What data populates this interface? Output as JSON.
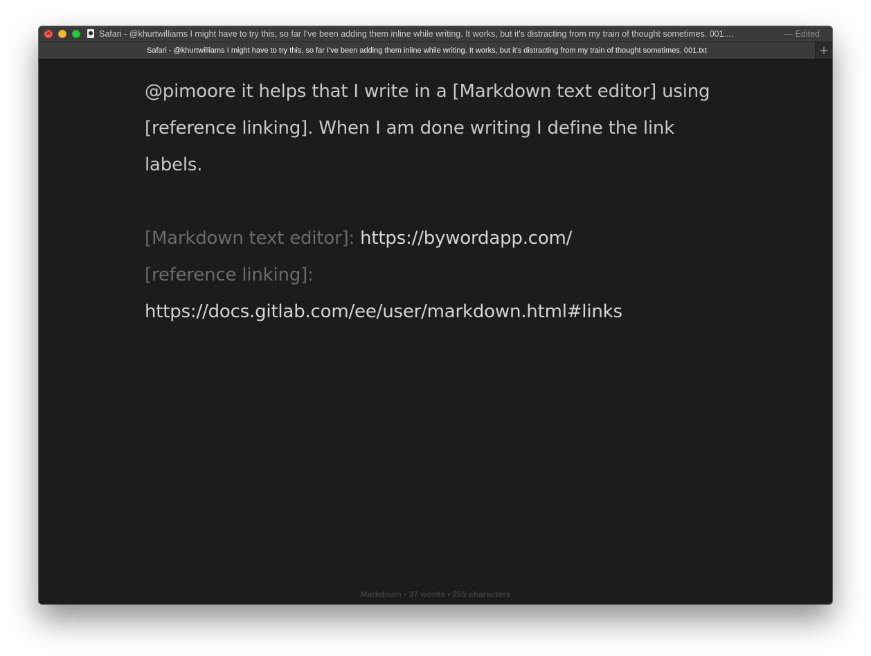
{
  "window": {
    "title": "Safari - @khurtwilliams I might have to try this, so far I've been adding them inline while writing. It works, but it's distracting from my train of thought sometimes. 001....",
    "edited_label": "— Edited"
  },
  "tabs": [
    {
      "label": "Safari - @khurtwilliams I might have to try this, so far I've been adding them inline while writing. It works, but it's distracting from my train of thought sometimes. 001.txt"
    }
  ],
  "new_tab_label": "+",
  "document": {
    "paragraph": "@pimoore it helps that I write in a [Markdown text editor] using [reference linking]. When I am done writing I define the link labels.",
    "references": [
      {
        "label": "[Markdown text editor]:",
        "url": "https://bywordapp.com/"
      },
      {
        "label": "[reference linking]:",
        "url": "https://docs.gitlab.com/ee/user/markdown.html#links"
      }
    ]
  },
  "status_bar": {
    "text": "Markdown • 37 words • 255 characters"
  },
  "colors": {
    "background": "#1c1c1c",
    "text": "#c9c9c9",
    "reference_label": "#6a6a6a",
    "close": "#fc5f57",
    "minimize": "#fdbc2e",
    "zoom": "#28c840"
  }
}
